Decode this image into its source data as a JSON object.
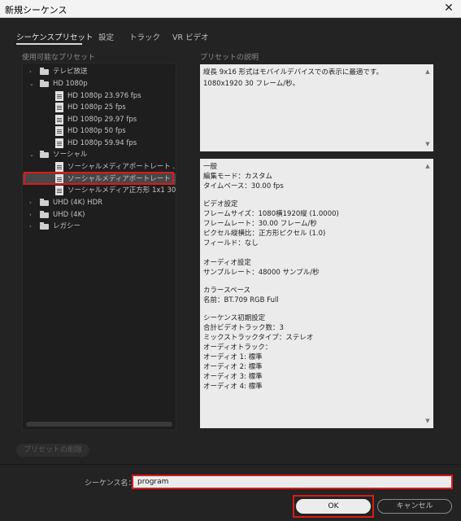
{
  "window": {
    "title": "新規シーケンス",
    "close_glyph": "✕"
  },
  "tabs": [
    {
      "label": "シーケンスプリセット",
      "active": true
    },
    {
      "label": "設定",
      "active": false
    },
    {
      "label": "トラック",
      "active": false
    },
    {
      "label": "VR ビデオ",
      "active": false
    }
  ],
  "presets_header": "使用可能なプリセット",
  "description_header": "プリセットの説明",
  "tree": [
    {
      "type": "folder",
      "label": "テレビ放送",
      "expanded": false
    },
    {
      "type": "folder",
      "label": "HD 1080p",
      "expanded": true
    },
    {
      "type": "file",
      "label": "HD 1080p 23.976 fps"
    },
    {
      "type": "file",
      "label": "HD 1080p 25 fps"
    },
    {
      "type": "file",
      "label": "HD 1080p 29.97 fps"
    },
    {
      "type": "file",
      "label": "HD 1080p 50 fps"
    },
    {
      "type": "file",
      "label": "HD 1080p 59.94 fps"
    },
    {
      "type": "folder",
      "label": "ソーシャル",
      "expanded": true
    },
    {
      "type": "file",
      "label": "ソーシャルメディアポートレート ..."
    },
    {
      "type": "file",
      "label": "ソーシャルメディアポートレート ...",
      "selected": true
    },
    {
      "type": "file",
      "label": "ソーシャルメディア正方形 1x1 30..."
    },
    {
      "type": "folder",
      "label": "UHD (4K) HDR",
      "expanded": false
    },
    {
      "type": "folder",
      "label": "UHD (4K)",
      "expanded": false
    },
    {
      "type": "folder",
      "label": "レガシー",
      "expanded": false
    }
  ],
  "description": "縦長 9x16 形式はモバイルデバイスでの表示に最適です。1080x1920 30 フレーム/秒。",
  "details": [
    "一般",
    "編集モード：カスタム",
    "タイムベース：30.00 fps",
    "",
    "ビデオ設定",
    "フレームサイズ：1080横1920縦 (1.0000)",
    "フレームレート：30.00 フレーム/秒",
    "ピクセル縦横比：正方形ピクセル (1.0)",
    "フィールド：なし",
    "",
    "オーディオ設定",
    "サンプルレート：48000 サンプル/秒",
    "",
    "カラースペース",
    "名前：BT.709 RGB Full",
    "",
    "シーケンス初期設定",
    "合計ビデオトラック数：3",
    "ミックストラックタイプ：ステレオ",
    "オーディオトラック：",
    "オーディオ 1: 標準",
    "オーディオ 2: 標準",
    "オーディオ 3: 標準",
    "オーディオ 4: 標準"
  ],
  "delete_button": "プリセットの削除",
  "sequence_name_label": "シーケンス名：",
  "sequence_name_value": "program",
  "ok_button": "OK",
  "cancel_button": "キャンセル",
  "icons": {
    "scroll_up": "▲",
    "scroll_down": "▼",
    "collapsed": "›",
    "expanded": "⌄"
  }
}
